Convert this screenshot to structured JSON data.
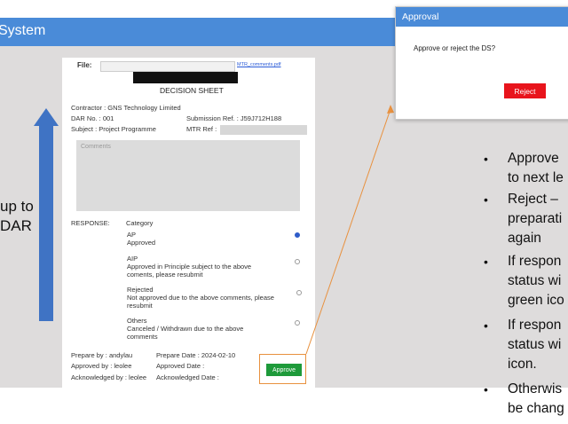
{
  "app": {
    "title": "System"
  },
  "left_text": {
    "line1": "up to",
    "line2": "DAR"
  },
  "document": {
    "file_label": "File:",
    "file_link": "MTR_comments.pdf",
    "sheet_title": "DECISION SHEET",
    "contractor": "Contractor : GNS Technology Limited",
    "dar_no": "DAR No. : 001",
    "submission_ref": "Submission Ref. : J59J712H188",
    "subject": "Subject : Project Programme",
    "mtr_ref": "MTR Ref :",
    "comments_placeholder": "Comments",
    "response_label": "RESPONSE:",
    "category_label": "Category",
    "options": [
      {
        "code": "AP",
        "desc1": "Approved",
        "desc2": "",
        "selected": true
      },
      {
        "code": "AIP",
        "desc1": "Approved in Principle subject to the above",
        "desc2": "coments, please resubmit",
        "selected": false
      },
      {
        "code": "Rejected",
        "desc1": "Not approved due to the above comments, please",
        "desc2": "resubmit",
        "selected": false
      },
      {
        "code": "Others",
        "desc1": "Canceled / Withdrawn due to the above",
        "desc2": "comments",
        "selected": false
      }
    ],
    "prepare_by": "Prepare by : andylau",
    "prepare_date": "Prepare Date : 2024-02-10",
    "approved_by": "Approved by : leolee",
    "approved_date": "Approved Date :",
    "acknowledged_by": "Acknowledged by : leolee",
    "acknowledged_date": "Acknowledged Date :",
    "approve_button": "Approve"
  },
  "dialog": {
    "title": "Approval",
    "message": "Approve or reject the DS?",
    "reject_button": "Reject"
  },
  "bullets": [
    [
      "Approve",
      "to next le"
    ],
    [
      "Reject –",
      "preparati",
      "again"
    ],
    [
      "If respon",
      "status wi",
      "green ico"
    ],
    [
      "If respon",
      "status wi",
      "icon."
    ],
    [
      "Otherwis",
      "be chang"
    ]
  ],
  "colors": {
    "header_blue": "#4a8bd8",
    "approve_green": "#1e9a3a",
    "reject_red": "#e8141c",
    "arrow_blue": "#3f73c4",
    "highlight_orange": "#e8913f"
  }
}
